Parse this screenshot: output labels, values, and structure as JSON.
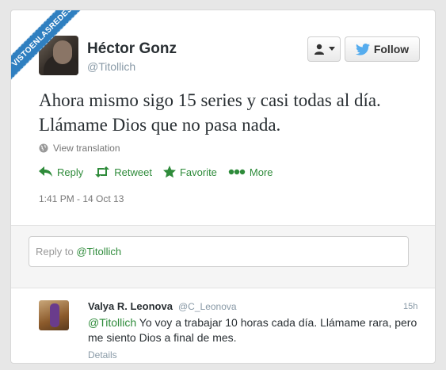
{
  "watermark": {
    "text": "VISTOENLASREDES"
  },
  "tweet": {
    "name": "Héctor Gonz",
    "handle": "@Titollich",
    "text": "Ahora mismo sigo 15 series y casi todas al día. Llámame Dios que no pasa nada.",
    "view_translation": "View translation",
    "timestamp": "1:41 PM - 14 Oct 13"
  },
  "buttons": {
    "follow": "Follow"
  },
  "actions": {
    "reply": "Reply",
    "retweet": "Retweet",
    "favorite": "Favorite",
    "more": "More"
  },
  "reply_box": {
    "prefix": "Reply to ",
    "mention": "@Titollich"
  },
  "reply": {
    "name": "Valya R. Leonova",
    "handle": "@C_Leonova",
    "time": "15h",
    "mention": "@Titollich",
    "text": " Yo voy a trabajar 10 horas cada día. Llámame rara, pero me siento Dios a final de mes.",
    "details": "Details"
  },
  "colors": {
    "accent_green": "#2e8b3a",
    "twitter_blue": "#55acee",
    "watermark_blue": "#2f7fc0"
  },
  "icons": [
    "user-icon",
    "chevron-down-icon",
    "twitter-bird-icon",
    "globe-icon",
    "reply-icon",
    "retweet-icon",
    "star-icon",
    "more-dots-icon"
  ]
}
